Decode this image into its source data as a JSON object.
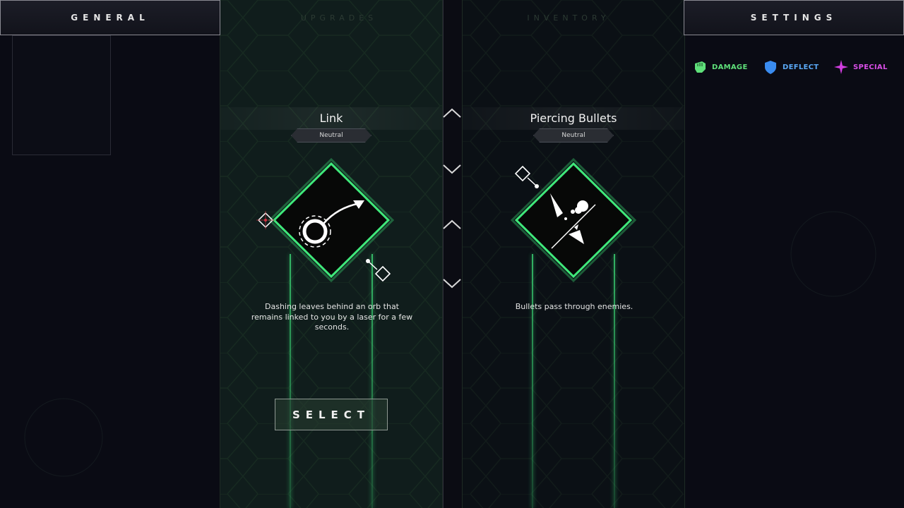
{
  "tabs": {
    "general": "GENERAL",
    "settings": "SETTINGS",
    "faint_left": "UPGRADES",
    "faint_right": "INVENTORY"
  },
  "legend": [
    {
      "label": "DAMAGE",
      "icon": "fist-icon",
      "color": "#5fe07a"
    },
    {
      "label": "DEFLECT",
      "icon": "shield-icon",
      "color": "#3a8cf0"
    },
    {
      "label": "SPECIAL",
      "icon": "sparkle-icon",
      "color": "#d23ee0"
    }
  ],
  "cards": [
    {
      "title": "Link",
      "tag": "Neutral",
      "icon": "orb-laser-icon",
      "description": "Dashing leaves behind an orb that remains linked to you by a laser for a few seconds.",
      "selected": true
    },
    {
      "title": "Piercing Bullets",
      "tag": "Neutral",
      "icon": "piercing-bullet-icon",
      "description": "Bullets pass through enemies.",
      "selected": false
    }
  ],
  "select_label": "SELECT",
  "colors": {
    "accent_green": "#3be070",
    "background": "#0a0b14"
  }
}
